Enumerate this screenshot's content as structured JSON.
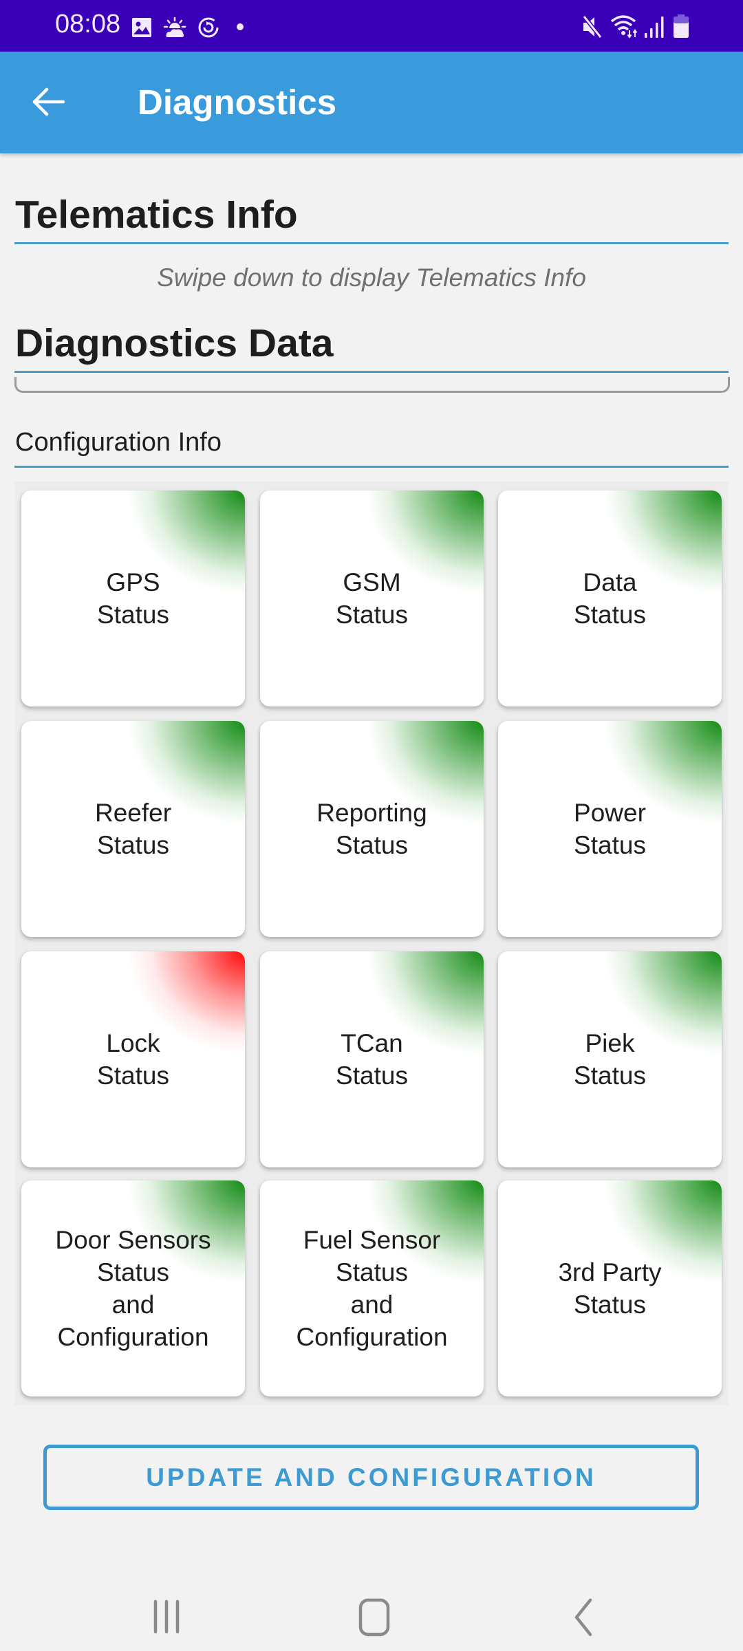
{
  "status_bar": {
    "time": "08:08",
    "left_icons": [
      "gallery-icon",
      "weather-icon",
      "sync-icon",
      "notification-dot-icon"
    ],
    "right_icons": [
      "mute-icon",
      "wifi-icon",
      "signal-icon",
      "battery-icon"
    ]
  },
  "app_bar": {
    "title": "Diagnostics",
    "back_icon": "arrow-left-icon"
  },
  "sections": {
    "telematics": {
      "title": "Telematics Info",
      "hint": "Swipe down to display Telematics Info"
    },
    "diagnostics": {
      "title": "Diagnostics Data"
    },
    "configuration": {
      "title": "Configuration Info"
    }
  },
  "status_cards": [
    {
      "label": "GPS\nStatus",
      "status": "ok",
      "color": "#148c14"
    },
    {
      "label": "GSM\nStatus",
      "status": "ok",
      "color": "#148c14"
    },
    {
      "label": "Data\nStatus",
      "status": "ok",
      "color": "#148c14"
    },
    {
      "label": "Reefer\nStatus",
      "status": "ok",
      "color": "#148c14"
    },
    {
      "label": "Reporting\nStatus",
      "status": "ok",
      "color": "#148c14"
    },
    {
      "label": "Power\nStatus",
      "status": "ok",
      "color": "#148c14"
    },
    {
      "label": "Lock\nStatus",
      "status": "error",
      "color": "#ff0a0a"
    },
    {
      "label": "TCan\nStatus",
      "status": "ok",
      "color": "#148c14"
    },
    {
      "label": "Piek\nStatus",
      "status": "ok",
      "color": "#148c14"
    },
    {
      "label": "Door Sensors\nStatus\nand\nConfiguration",
      "status": "ok",
      "color": "#148c14"
    },
    {
      "label": "Fuel Sensor\nStatus\nand\nConfiguration",
      "status": "ok",
      "color": "#148c14"
    },
    {
      "label": "3rd Party\nStatus",
      "status": "ok",
      "color": "#148c14"
    }
  ],
  "actions": {
    "update_label": "UPDATE AND CONFIGURATION"
  },
  "nav_bar": {
    "buttons": [
      "recents-icon",
      "home-icon",
      "back-icon"
    ]
  },
  "colors": {
    "status_bar": "#3a00b8",
    "app_bar": "#3a9bdc",
    "accent": "#3d9ad2",
    "ok": "#148c14",
    "error": "#ff0a0a"
  }
}
